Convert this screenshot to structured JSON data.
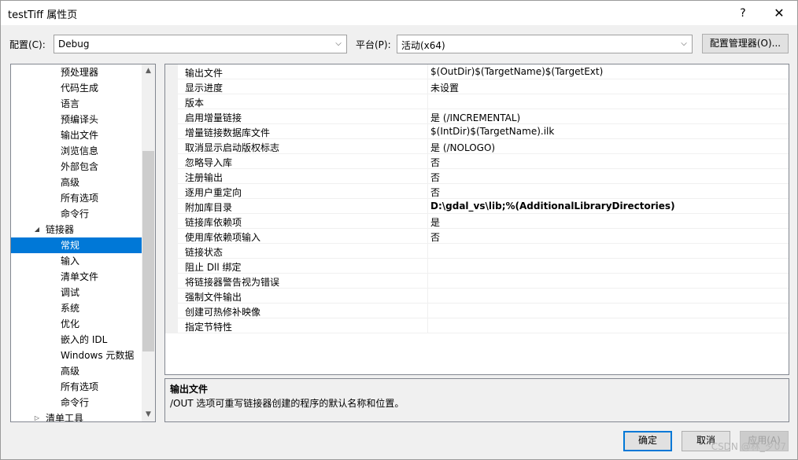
{
  "window": {
    "title": "testTiff 属性页",
    "help": "?",
    "close": "✕"
  },
  "config": {
    "config_label": "配置(C):",
    "config_value": "Debug",
    "platform_label": "平台(P):",
    "platform_value": "活动(x64)",
    "manager_button": "配置管理器(O)..."
  },
  "tree": {
    "items": [
      {
        "label": "预处理器"
      },
      {
        "label": "代码生成"
      },
      {
        "label": "语言"
      },
      {
        "label": "预编译头"
      },
      {
        "label": "输出文件"
      },
      {
        "label": "浏览信息"
      },
      {
        "label": "外部包含"
      },
      {
        "label": "高级"
      },
      {
        "label": "所有选项"
      },
      {
        "label": "命令行"
      },
      {
        "label": "链接器",
        "expanded": true
      },
      {
        "label": "常规",
        "selected": true
      },
      {
        "label": "输入"
      },
      {
        "label": "清单文件"
      },
      {
        "label": "调试"
      },
      {
        "label": "系统"
      },
      {
        "label": "优化"
      },
      {
        "label": "嵌入的 IDL"
      },
      {
        "label": "Windows 元数据"
      },
      {
        "label": "高级"
      },
      {
        "label": "所有选项"
      },
      {
        "label": "命令行"
      },
      {
        "label": "清单工具",
        "expanded": false
      }
    ]
  },
  "grid": {
    "rows": [
      {
        "name": "输出文件",
        "value": "$(OutDir)$(TargetName)$(TargetExt)"
      },
      {
        "name": "显示进度",
        "value": "未设置"
      },
      {
        "name": "版本",
        "value": ""
      },
      {
        "name": "启用增量链接",
        "value": "是 (/INCREMENTAL)"
      },
      {
        "name": "增量链接数据库文件",
        "value": "$(IntDir)$(TargetName).ilk"
      },
      {
        "name": "取消显示启动版权标志",
        "value": "是 (/NOLOGO)"
      },
      {
        "name": "忽略导入库",
        "value": "否"
      },
      {
        "name": "注册输出",
        "value": "否"
      },
      {
        "name": "逐用户重定向",
        "value": "否"
      },
      {
        "name": "附加库目录",
        "value": "D:\\gdal_vs\\lib;%(AdditionalLibraryDirectories)",
        "bold": true
      },
      {
        "name": "链接库依赖项",
        "value": "是"
      },
      {
        "name": "使用库依赖项输入",
        "value": "否"
      },
      {
        "name": "链接状态",
        "value": ""
      },
      {
        "name": "阻止 Dll 绑定",
        "value": ""
      },
      {
        "name": "将链接器警告视为错误",
        "value": ""
      },
      {
        "name": "强制文件输出",
        "value": ""
      },
      {
        "name": "创建可热修补映像",
        "value": ""
      },
      {
        "name": "指定节特性",
        "value": ""
      }
    ]
  },
  "description": {
    "title": "输出文件",
    "text": "/OUT 选项可重写链接器创建的程序的默认名称和位置。"
  },
  "buttons": {
    "ok": "确定",
    "cancel": "取消",
    "apply": "应用(A)"
  },
  "watermark": "CSDN @林_夕07"
}
